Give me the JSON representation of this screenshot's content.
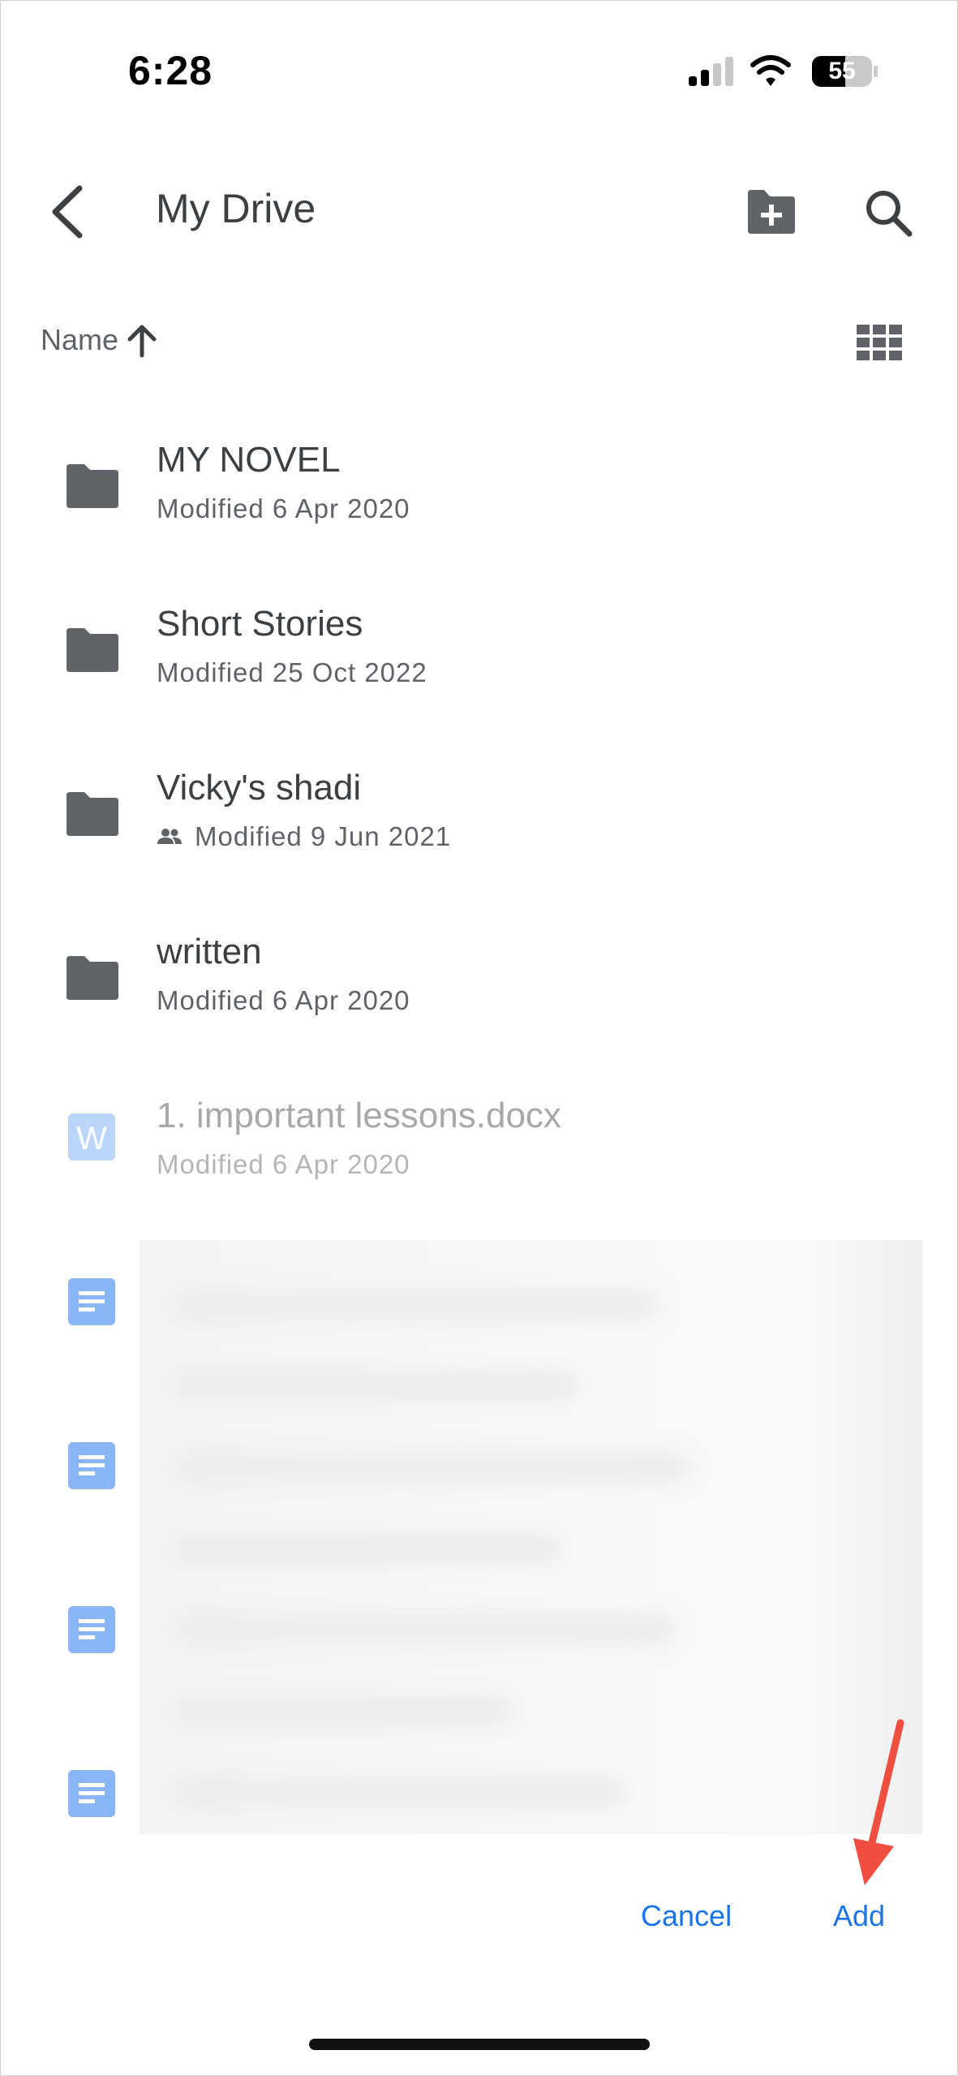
{
  "status_bar": {
    "time": "6:28",
    "battery": "55"
  },
  "header": {
    "title": "My Drive"
  },
  "sort": {
    "label": "Name"
  },
  "items": [
    {
      "name": "MY NOVEL",
      "meta": "Modified 6 Apr 2020",
      "icon": "folder-icon"
    },
    {
      "name": "Short Stories",
      "meta": "Modified 25 Oct 2022",
      "icon": "folder-icon"
    },
    {
      "name": "Vicky's shadi",
      "meta": "Modified 9 Jun 2021",
      "icon": "folder-icon",
      "shared": true
    },
    {
      "name": "written",
      "meta": "Modified 6 Apr 2020",
      "icon": "folder-icon"
    },
    {
      "name": "1. important lessons.docx",
      "meta": "Modified 6 Apr 2020",
      "icon": "word-icon",
      "disabled": true
    }
  ],
  "actions": {
    "cancel": "Cancel",
    "add": "Add"
  },
  "colors": {
    "accent": "#1a73e8",
    "annotation": "#f04e3e",
    "docs_blue": "#8ab4f8"
  }
}
